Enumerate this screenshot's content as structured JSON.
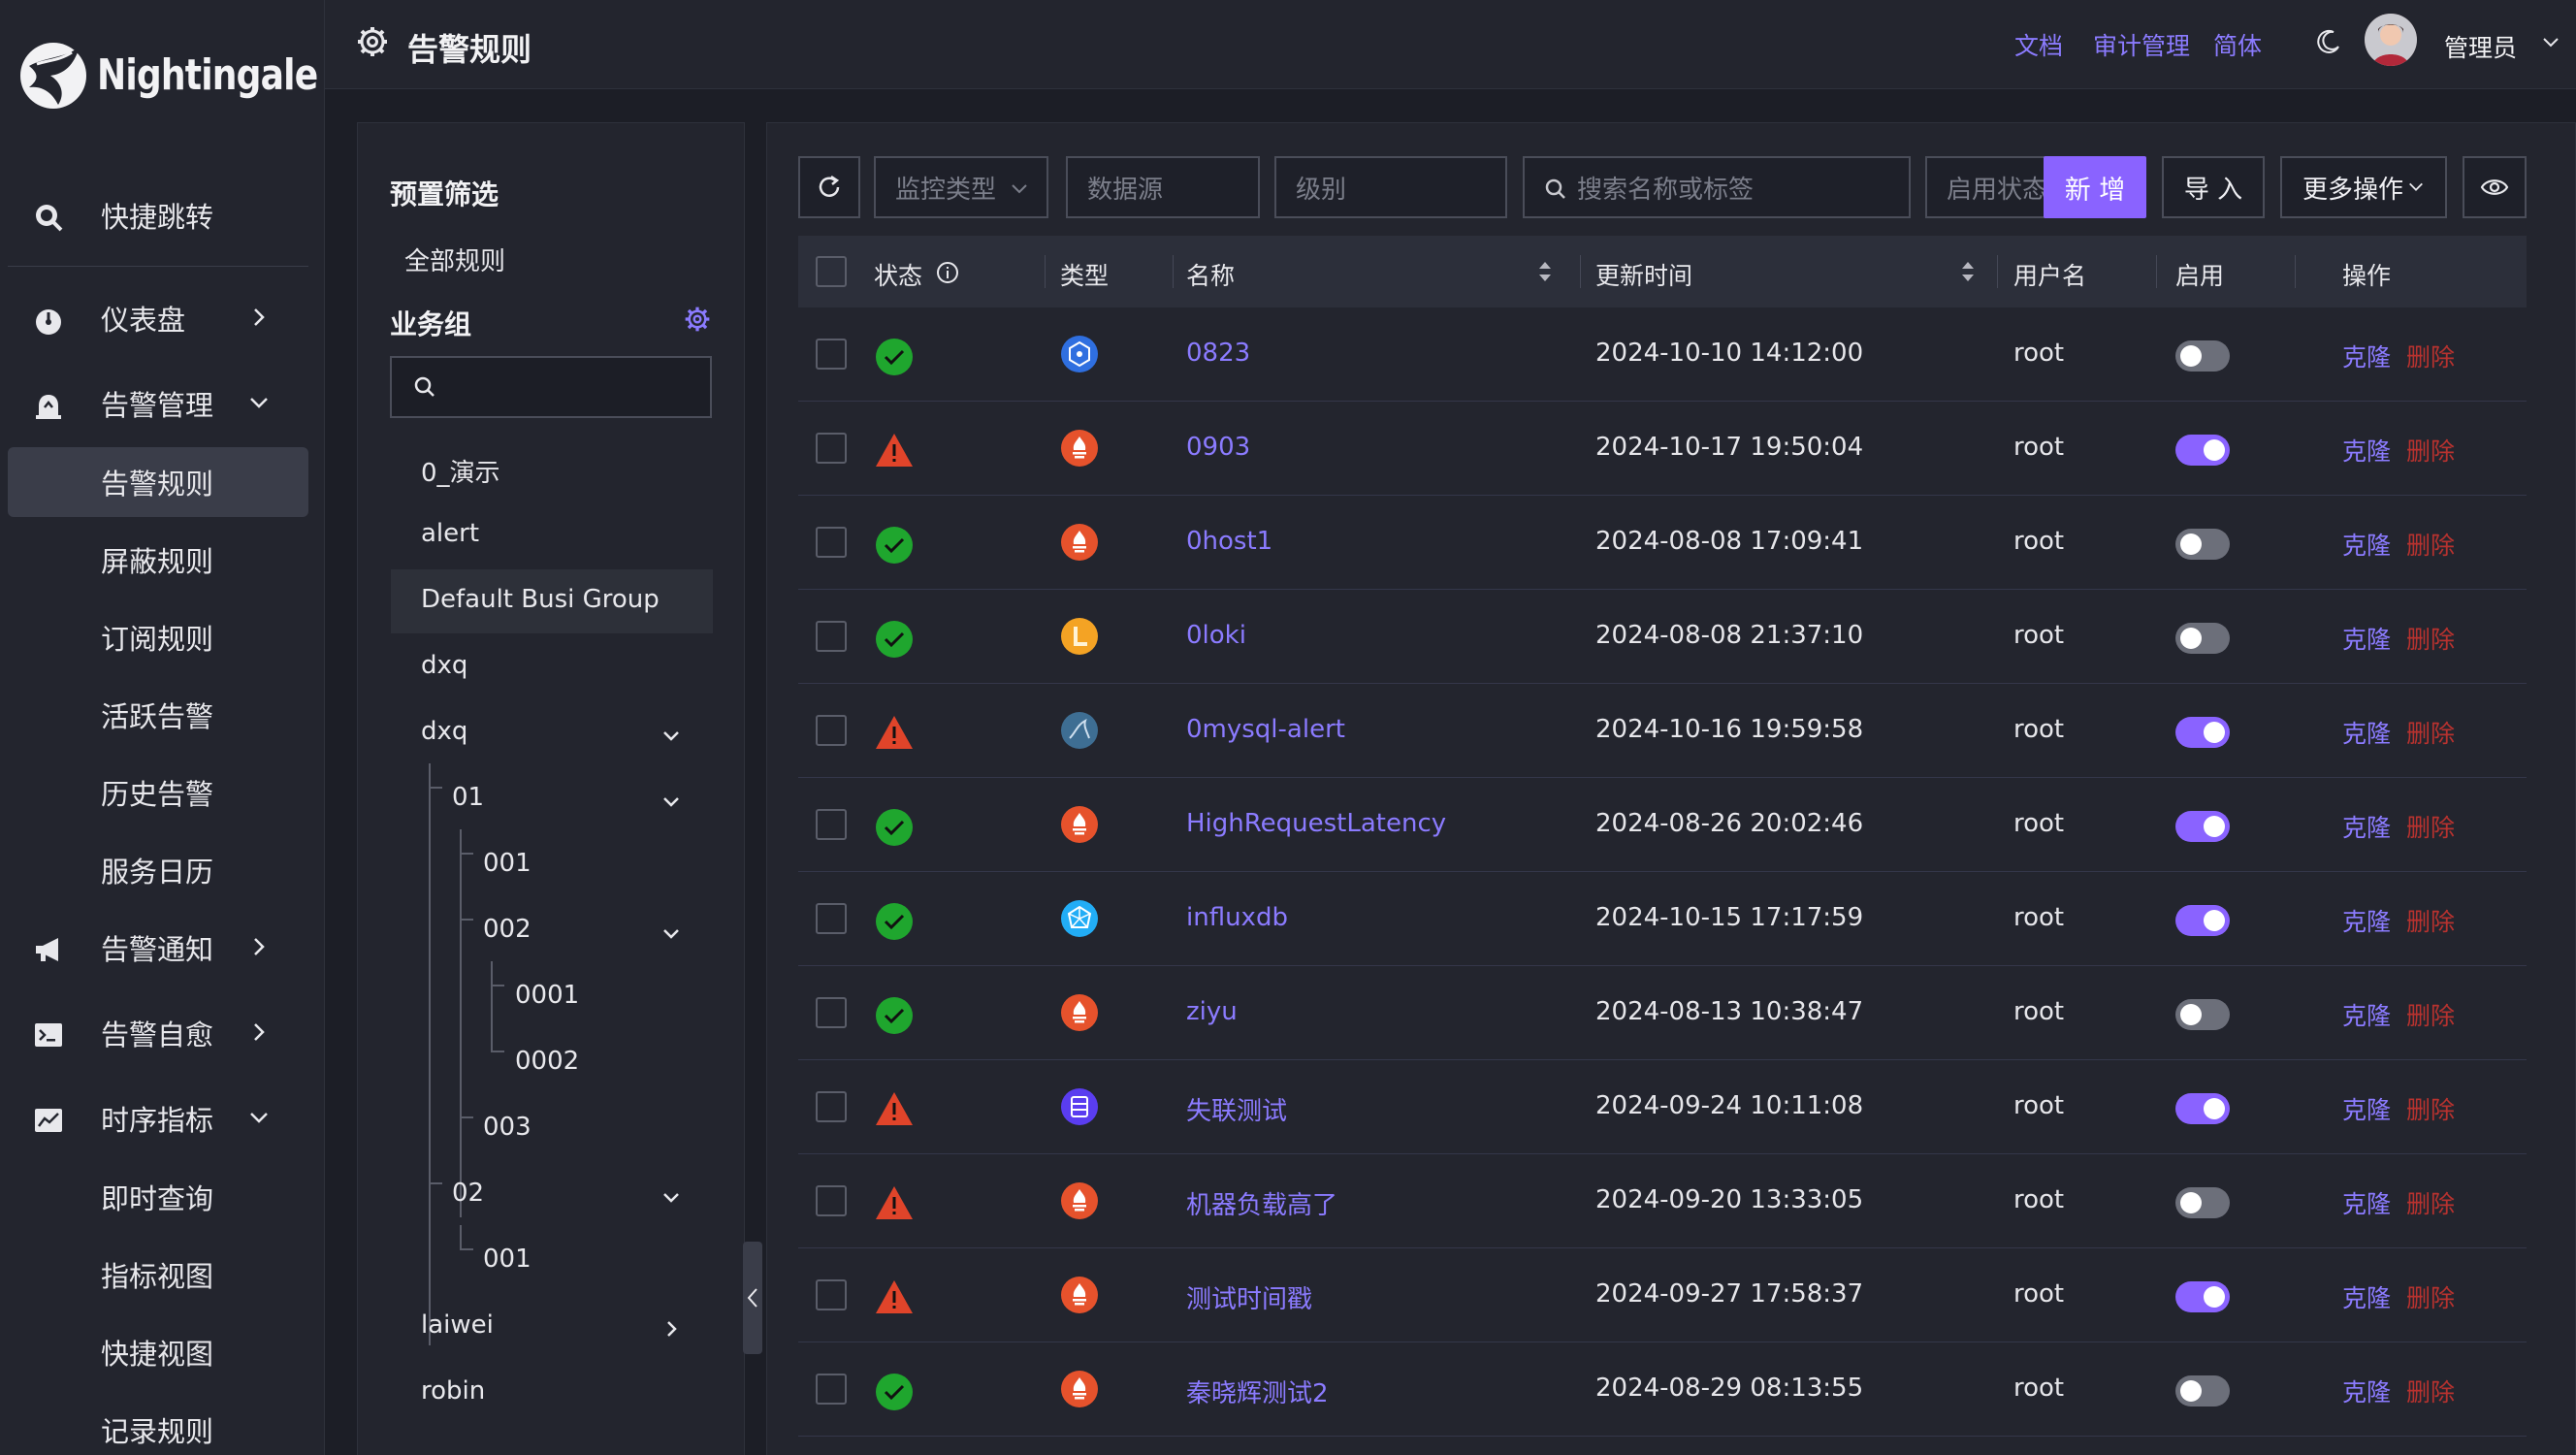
{
  "app": {
    "name": "Nightingale"
  },
  "sidebar": {
    "items": [
      {
        "label": "快捷跳转",
        "icon": "search-icon"
      },
      {
        "label": "仪表盘",
        "icon": "dashboard-icon"
      },
      {
        "label": "告警管理",
        "icon": "alarm-icon"
      },
      {
        "label": "告警规则"
      },
      {
        "label": "屏蔽规则"
      },
      {
        "label": "订阅规则"
      },
      {
        "label": "活跃告警"
      },
      {
        "label": "历史告警"
      },
      {
        "label": "服务日历"
      },
      {
        "label": "告警通知",
        "icon": "megaphone-icon"
      },
      {
        "label": "告警自愈",
        "icon": "terminal-icon"
      },
      {
        "label": "时序指标",
        "icon": "chart-line-icon"
      },
      {
        "label": "即时查询"
      },
      {
        "label": "指标视图"
      },
      {
        "label": "快捷视图"
      },
      {
        "label": "记录规则"
      }
    ]
  },
  "header": {
    "title": "告警规则",
    "links": [
      "文档",
      "审计管理",
      "简体"
    ],
    "user": "管理员"
  },
  "filter": {
    "preset_title": "预置筛选",
    "all_rules": "全部规则",
    "group_title": "业务组",
    "tree": [
      "0_演示",
      "alert",
      "Default Busi Group",
      "dxq",
      "dxq",
      "01",
      "001",
      "002",
      "0001",
      "0002",
      "003",
      "02",
      "001",
      "laiwei",
      "robin"
    ]
  },
  "toolbar": {
    "monitor_type": "监控类型",
    "datasource": "数据源",
    "level": "级别",
    "search_placeholder": "搜索名称或标签",
    "enable_status": "启用状态",
    "add": "新 增",
    "import": "导 入",
    "more": "更多操作"
  },
  "table": {
    "headers": [
      "状态",
      "类型",
      "名称",
      "更新时间",
      "用户名",
      "启用",
      "操作"
    ],
    "action_clone": "克隆",
    "action_delete": "删除",
    "rows": [
      {
        "status": "ok",
        "type": "kubernetes",
        "name": "0823",
        "updated": "2024-10-10 14:12:00",
        "user": "root",
        "enabled": false
      },
      {
        "status": "warn",
        "type": "prometheus",
        "name": "0903",
        "updated": "2024-10-17 19:50:04",
        "user": "root",
        "enabled": true
      },
      {
        "status": "ok",
        "type": "prometheus",
        "name": "0host1",
        "updated": "2024-08-08 17:09:41",
        "user": "root",
        "enabled": false
      },
      {
        "status": "ok",
        "type": "loki",
        "name": "0loki",
        "updated": "2024-08-08 21:37:10",
        "user": "root",
        "enabled": false
      },
      {
        "status": "warn",
        "type": "mysql",
        "name": "0mysql-alert",
        "updated": "2024-10-16 19:59:58",
        "user": "root",
        "enabled": true
      },
      {
        "status": "ok",
        "type": "prometheus",
        "name": "HighRequestLatency",
        "updated": "2024-08-26 20:02:46",
        "user": "root",
        "enabled": true
      },
      {
        "status": "ok",
        "type": "influxdb",
        "name": "influxdb",
        "updated": "2024-10-15 17:17:59",
        "user": "root",
        "enabled": true
      },
      {
        "status": "ok",
        "type": "prometheus",
        "name": "ziyu",
        "updated": "2024-08-13 10:38:47",
        "user": "root",
        "enabled": false
      },
      {
        "status": "warn",
        "type": "host",
        "name": "失联测试",
        "updated": "2024-09-24 10:11:08",
        "user": "root",
        "enabled": true
      },
      {
        "status": "warn",
        "type": "prometheus",
        "name": "机器负载高了",
        "updated": "2024-09-20 13:33:05",
        "user": "root",
        "enabled": false
      },
      {
        "status": "warn",
        "type": "prometheus",
        "name": "测试时间戳",
        "updated": "2024-09-27 17:58:37",
        "user": "root",
        "enabled": true
      },
      {
        "status": "ok",
        "type": "prometheus",
        "name": "秦晓辉测试2",
        "updated": "2024-08-29 08:13:55",
        "user": "root",
        "enabled": false
      }
    ]
  },
  "colors": {
    "accent": "#8a63ff",
    "ok": "#1fa62e",
    "warn": "#e0442a",
    "delete": "#b8322f"
  }
}
